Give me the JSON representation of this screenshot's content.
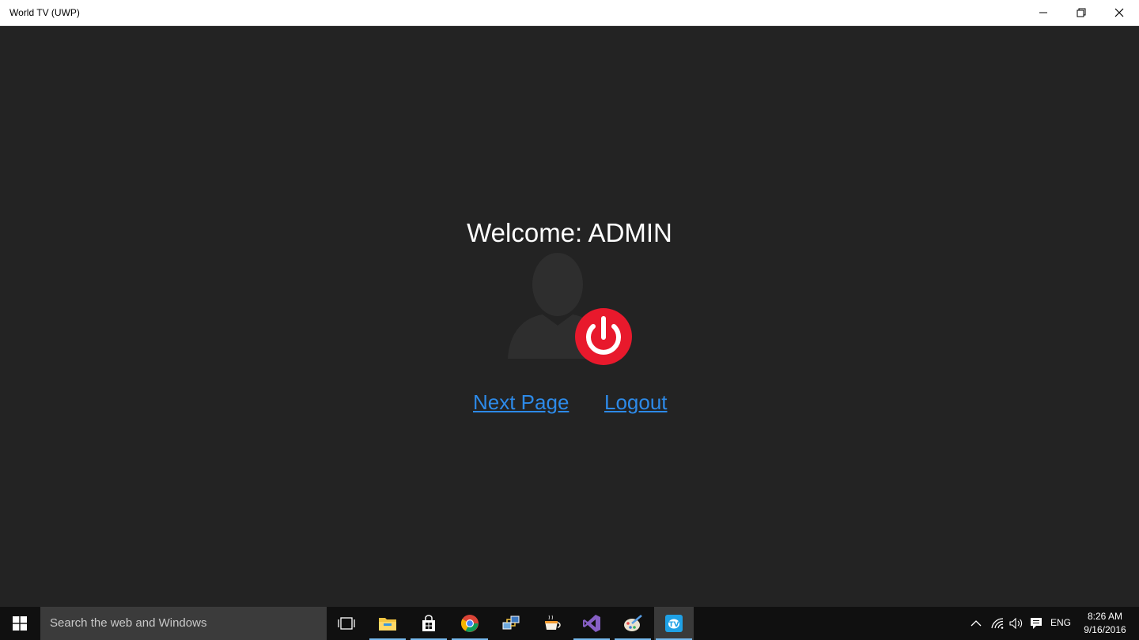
{
  "window": {
    "title": "World TV (UWP)",
    "minimize_icon": "minimize-icon",
    "restore_icon": "restore-icon",
    "close_icon": "close-icon"
  },
  "main": {
    "welcome_text": "Welcome: ADMIN",
    "avatar_icon": "user-silhouette-icon",
    "power_icon": "power-icon",
    "links": {
      "next_page": "Next Page",
      "logout": "Logout"
    }
  },
  "colors": {
    "background": "#232323",
    "link": "#2d8ae8",
    "power_button": "#e8192c",
    "taskbar": "#101010"
  },
  "taskbar": {
    "search_placeholder": "Search the web and Windows",
    "apps": [
      {
        "icon": "task-view-icon",
        "running": false
      },
      {
        "icon": "file-explorer-icon",
        "running": true
      },
      {
        "icon": "store-icon",
        "running": true
      },
      {
        "icon": "chrome-icon",
        "running": true
      },
      {
        "icon": "network-icon",
        "running": false
      },
      {
        "icon": "coffee-app-icon",
        "running": false
      },
      {
        "icon": "visual-studio-icon",
        "running": true
      },
      {
        "icon": "paint-icon",
        "running": true
      },
      {
        "icon": "world-tv-icon",
        "running": true,
        "active": true
      }
    ],
    "tray": {
      "language": "ENG",
      "time": "8:26 AM",
      "date": "9/16/2016"
    }
  }
}
